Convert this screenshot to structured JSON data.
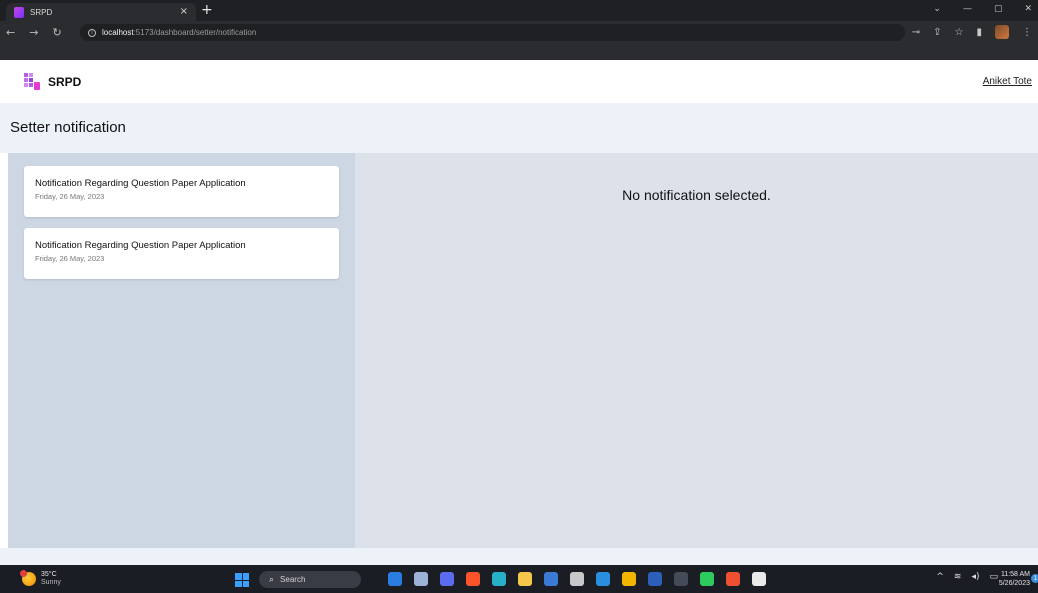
{
  "browser": {
    "tab_title": "SRPD",
    "tab_close": "×",
    "new_tab": "+",
    "url_host": "localhost",
    "url_path": ":5173/dashboard/setter/notification"
  },
  "app": {
    "name": "SRPD",
    "user_name": "Aniket Tote"
  },
  "page": {
    "title": "Setter notification"
  },
  "notifications": [
    {
      "title": "Notification Regarding Question Paper Application",
      "date": "Friday, 26 May, 2023"
    },
    {
      "title": "Notification Regarding Question Paper Application",
      "date": "Friday, 26 May, 2023"
    }
  ],
  "detail": {
    "empty_message": "No notification selected."
  },
  "taskbar": {
    "weather_temp": "35°C",
    "weather_condition": "Sunny",
    "search_label": "Search",
    "time": "11:58 AM",
    "date": "5/26/2023",
    "notification_count": "1",
    "icons": [
      {
        "name": "edge-copilot-icon",
        "color": "#2a7de1"
      },
      {
        "name": "file-explorer-icon",
        "color": "#9ab3d6"
      },
      {
        "name": "chat-icon",
        "color": "#5b6cf0"
      },
      {
        "name": "brave-icon",
        "color": "#fb542b"
      },
      {
        "name": "edge-icon",
        "color": "#28b0c9"
      },
      {
        "name": "folder-icon",
        "color": "#f5c84c"
      },
      {
        "name": "notes-icon",
        "color": "#3b7bd6"
      },
      {
        "name": "calculator-icon",
        "color": "#c8c8c8"
      },
      {
        "name": "vscode-icon",
        "color": "#2b8fe0"
      },
      {
        "name": "chrome-icon",
        "color": "#f2b600"
      },
      {
        "name": "word-icon",
        "color": "#2b5fb8"
      },
      {
        "name": "notion-icon",
        "color": "#444a57"
      },
      {
        "name": "whatsapp-icon",
        "color": "#2ecc5f"
      },
      {
        "name": "git-icon",
        "color": "#f05032"
      },
      {
        "name": "mongodb-icon",
        "color": "#eaeaea"
      }
    ]
  }
}
